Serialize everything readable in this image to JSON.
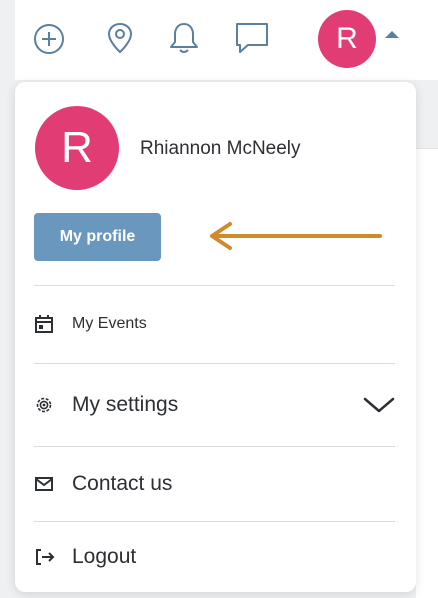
{
  "topbar": {
    "icons": [
      "add-circle-icon",
      "location-pin-icon",
      "bell-icon",
      "chat-icon"
    ],
    "avatar_letter": "R",
    "accent": "#5b7f9f"
  },
  "dropdown": {
    "avatar_letter": "R",
    "user_name": "Rhiannon McNeely",
    "profile_button": "My profile",
    "items": [
      {
        "label": "My Events",
        "icon": "calendar-icon"
      },
      {
        "label": "My settings",
        "icon": "gear-icon",
        "expandable": true
      },
      {
        "label": "Contact us",
        "icon": "envelope-icon"
      },
      {
        "label": "Logout",
        "icon": "logout-icon"
      }
    ]
  },
  "colors": {
    "avatar": "#e23c74",
    "primary_button": "#6a97bd",
    "annotation_arrow": "#d08a2a"
  }
}
